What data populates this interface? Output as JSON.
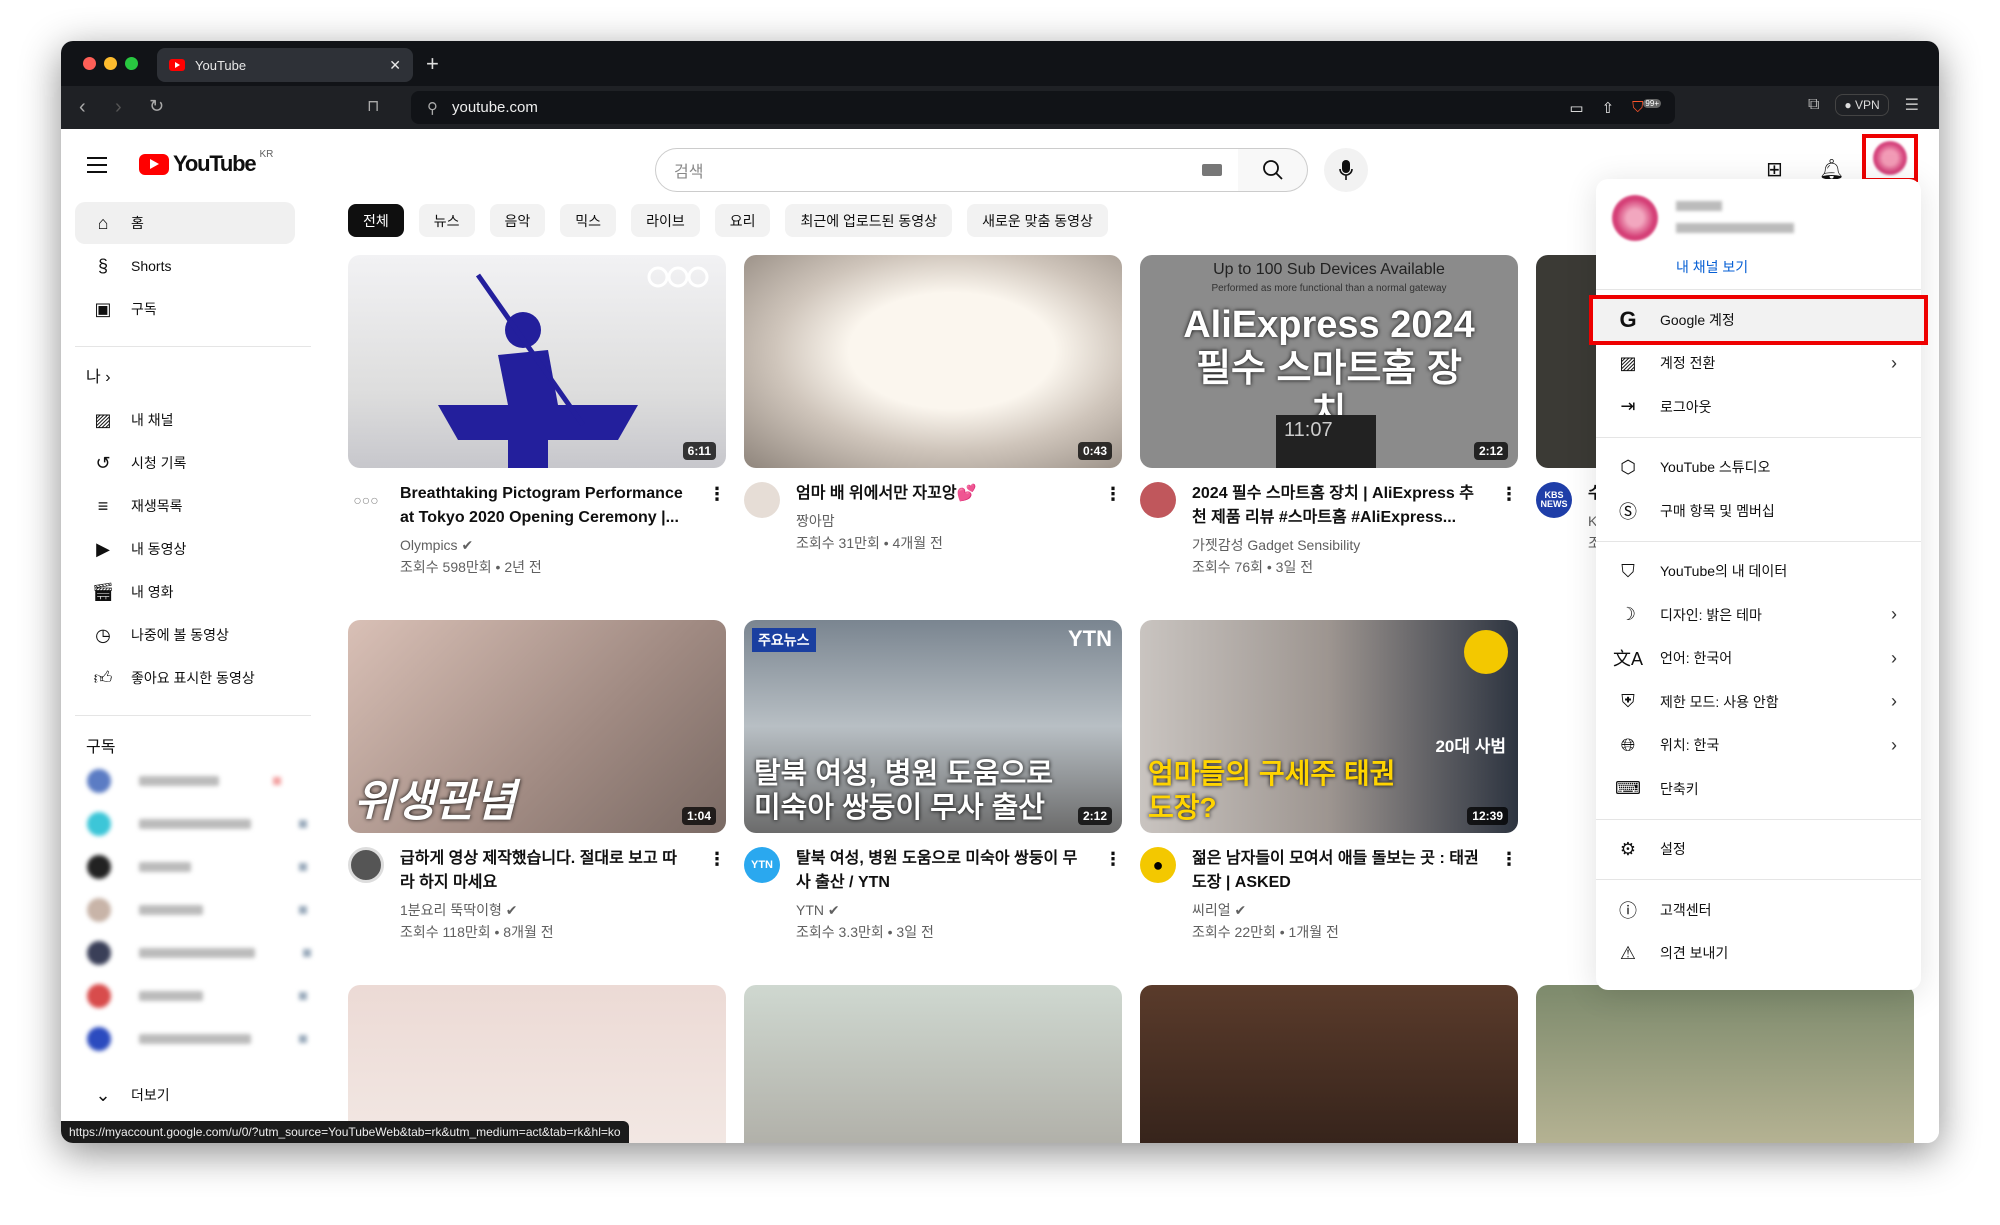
{
  "browser": {
    "tab_title": "YouTube",
    "url": "youtube.com",
    "brave_badge": "99+",
    "vpn_label": "VPN"
  },
  "header": {
    "logo": "YouTube",
    "region": "KR",
    "search_placeholder": "검색"
  },
  "sidebar": {
    "main": [
      {
        "label": "홈",
        "icon": "home-icon"
      },
      {
        "label": "Shorts",
        "icon": "shorts-icon"
      },
      {
        "label": "구독",
        "icon": "subscriptions-icon"
      }
    ],
    "you_heading": "나",
    "you": [
      {
        "label": "내 채널",
        "icon": "channel-icon"
      },
      {
        "label": "시청 기록",
        "icon": "history-icon"
      },
      {
        "label": "재생목록",
        "icon": "playlist-icon"
      },
      {
        "label": "내 동영상",
        "icon": "video-icon"
      },
      {
        "label": "내 영화",
        "icon": "movie-icon"
      },
      {
        "label": "나중에 볼 동영상",
        "icon": "watch-later-icon"
      },
      {
        "label": "좋아요 표시한 동영상",
        "icon": "like-icon"
      }
    ],
    "subs_heading": "구독",
    "more": "더보기"
  },
  "chips": [
    "전체",
    "뉴스",
    "음악",
    "믹스",
    "라이브",
    "요리",
    "최근에 업로드된 동영상",
    "새로운 맞춤 동영상"
  ],
  "videos": [
    {
      "title": "Breathtaking Pictogram Performance at Tokyo 2020 Opening Ceremony |...",
      "channel": "Olympics",
      "verified": true,
      "stats": "조회수 598만회 • 2년 전",
      "duration": "6:11"
    },
    {
      "title": "엄마 배 위에서만 자꼬앙💕",
      "channel": "짱아맘",
      "verified": false,
      "stats": "조회수 31만회 • 4개월 전",
      "duration": "0:43"
    },
    {
      "title": "2024 필수 스마트홈 장치 | AliExpress 추천 제품 리뷰 #스마트홈 #AliExpress...",
      "channel": "가젯감성 Gadget Sensibility",
      "verified": false,
      "stats": "조회수 76회 • 3일 전",
      "duration": "2:12",
      "overlay_top": "Up to 100 Sub Devices Available",
      "overlay_sub": "Performed as more functional than a normal gateway",
      "overlay_main": "AliExpress 2024필수 스마트홈 장치",
      "overlay_clock": "11:07"
    },
    {
      "title": "수",
      "channel": "K",
      "stats": "조",
      "duration": "",
      "avatar_text": "KBS NEWS"
    },
    {
      "title": "급하게 영상 제작했습니다. 절대로 보고 따라 하지 마세요",
      "channel": "1분요리 뚝딱이형",
      "verified": true,
      "stats": "조회수 118만회 • 8개월 전",
      "duration": "1:04",
      "overlay_main": "위생관념"
    },
    {
      "title": "탈북 여성, 병원 도움으로 미숙아 쌍둥이 무사 출산 / YTN",
      "channel": "YTN",
      "verified": true,
      "stats": "조회수 3.3만회 • 3일 전",
      "duration": "2:12",
      "avatar_text": "YTN",
      "overlay_tag": "주요뉴스",
      "overlay_logo": "YTN",
      "overlay_main": "탈북 여성, 병원 도움으로 미숙아 쌍둥이 무사 출산"
    },
    {
      "title": "젊은 남자들이 모여서 애들 돌보는 곳 : 태권도장 | ASKED",
      "channel": "씨리얼",
      "verified": true,
      "stats": "조회수 22만회 • 1개월 전",
      "duration": "12:39",
      "overlay_main": "엄마들의 구세주 태권도장?",
      "overlay_tag": "20대 사범"
    }
  ],
  "menu": {
    "view_channel": "내 채널 보기",
    "groups": [
      [
        {
          "label": "Google 계정",
          "icon": "google-icon",
          "highlighted": true
        },
        {
          "label": "계정 전환",
          "icon": "switch-account-icon",
          "chevron": true
        },
        {
          "label": "로그아웃",
          "icon": "sign-out-icon"
        }
      ],
      [
        {
          "label": "YouTube 스튜디오",
          "icon": "studio-icon"
        },
        {
          "label": "구매 항목 및 멤버십",
          "icon": "dollar-icon"
        }
      ],
      [
        {
          "label": "YouTube의 내 데이터",
          "icon": "data-shield-icon"
        },
        {
          "label": "디자인: 밝은 테마",
          "icon": "moon-icon",
          "chevron": true
        },
        {
          "label": "언어: 한국어",
          "icon": "translate-icon",
          "chevron": true
        },
        {
          "label": "제한 모드: 사용 안함",
          "icon": "restricted-icon",
          "chevron": true
        },
        {
          "label": "위치: 한국",
          "icon": "globe-icon",
          "chevron": true
        },
        {
          "label": "단축키",
          "icon": "keyboard-icon"
        }
      ],
      [
        {
          "label": "설정",
          "icon": "gear-icon"
        }
      ],
      [
        {
          "label": "고객센터",
          "icon": "help-icon"
        },
        {
          "label": "의견 보내기",
          "icon": "feedback-icon"
        }
      ]
    ]
  },
  "status_url": "https://myaccount.google.com/u/0/?utm_source=YouTubeWeb&tab=rk&utm_medium=act&tab=rk&hl=ko",
  "colors": {
    "brand": "#ff0000",
    "highlight_box": "#e00000",
    "link": "#065fd4"
  }
}
